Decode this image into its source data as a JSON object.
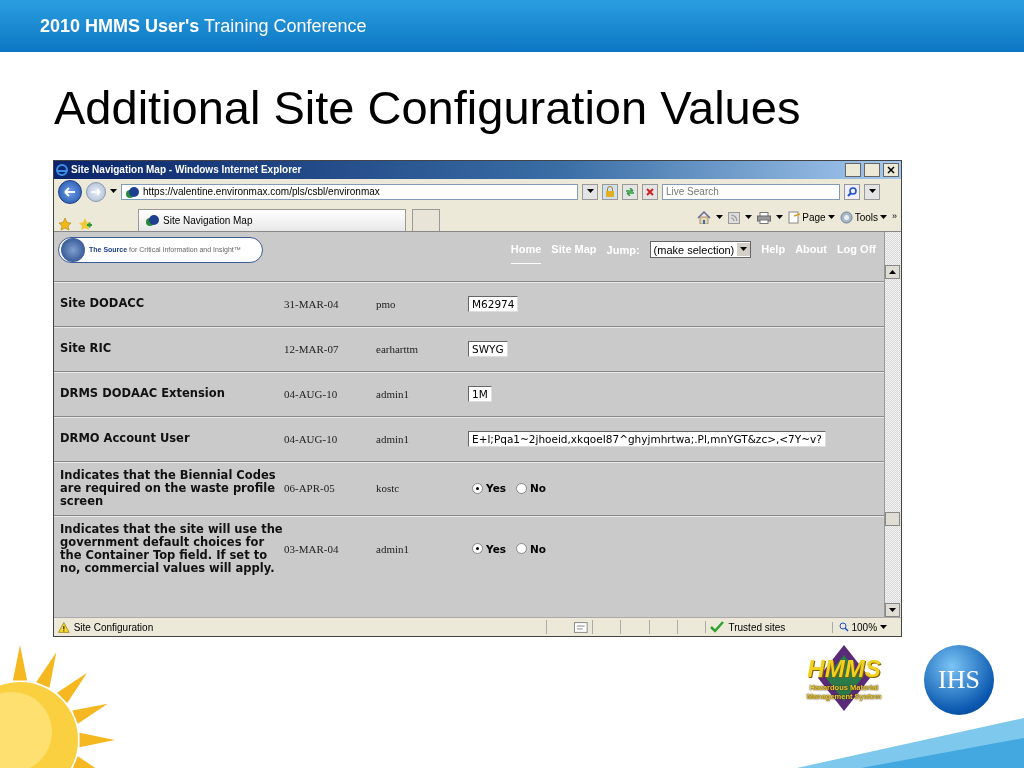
{
  "slide": {
    "header": "**2010 HMMS User's** Training Conference",
    "title": "Additional Site Configuration Values"
  },
  "browser": {
    "title": "Site Navigation Map - Windows Internet Explorer",
    "address": "https://valentine.environmax.com/pls/csbl/environmax",
    "search": {
      "placeholder": "Live Search"
    },
    "tab": "Site Navigation Map",
    "commands": [
      "Page",
      "Tools"
    ],
    "overflow": "»"
  },
  "site": {
    "tagline": "**The Source** for Critical Information and Insight™",
    "nav_left": [
      {
        "label": "Home",
        "selected": true
      },
      {
        "label": "Site Map",
        "selected": false
      }
    ],
    "jump": {
      "label": "Jump:",
      "value": "(make selection)"
    },
    "nav_right": [
      {
        "label": "Help",
        "selected": false
      },
      {
        "label": "About",
        "selected": false
      },
      {
        "label": "Log Off",
        "selected": false
      }
    ]
  },
  "rows": [
    {
      "label": "Site DODACC",
      "date": "31-MAR-04",
      "user": "pmo",
      "kind": "text",
      "value": "M62974"
    },
    {
      "label": "Site RIC",
      "date": "12-MAR-07",
      "user": "earharttm",
      "kind": "text",
      "value": "SWYG"
    },
    {
      "label": "DRMS DODAAC Extension",
      "date": "04-AUG-10",
      "user": "admin1",
      "kind": "text",
      "value": "1M"
    },
    {
      "label": "DRMO Account User",
      "date": "04-AUG-10",
      "user": "admin1",
      "kind": "text",
      "value": "E+l;Pqa1~2jhoeid,xkqoeI87^ghyjmhrtwa;.Pl,mnYGT&zc>,<7Y~v?"
    },
    {
      "label": "Indicates that the Biennial Codes are required on the waste profile screen",
      "date": "06-APR-05",
      "user": "kostc",
      "kind": "radio",
      "options": [
        {
          "label": "Yes",
          "selected": true
        },
        {
          "label": "No",
          "selected": false
        }
      ]
    },
    {
      "label": "Indicates that the site will use the government default choices for the Container Top field. If set to no, commercial values will apply.",
      "date": "03-MAR-04",
      "user": "admin1",
      "kind": "radio",
      "options": [
        {
          "label": "Yes",
          "selected": true
        },
        {
          "label": "No",
          "selected": false
        }
      ]
    }
  ],
  "status_bar": {
    "text": "Site Configuration",
    "zone": "Trusted sites",
    "zoom": "100%"
  },
  "logos": {
    "hmms": "HMMS",
    "hmms_caption": "Hazardous Material Management System",
    "ihs": "IHS"
  }
}
